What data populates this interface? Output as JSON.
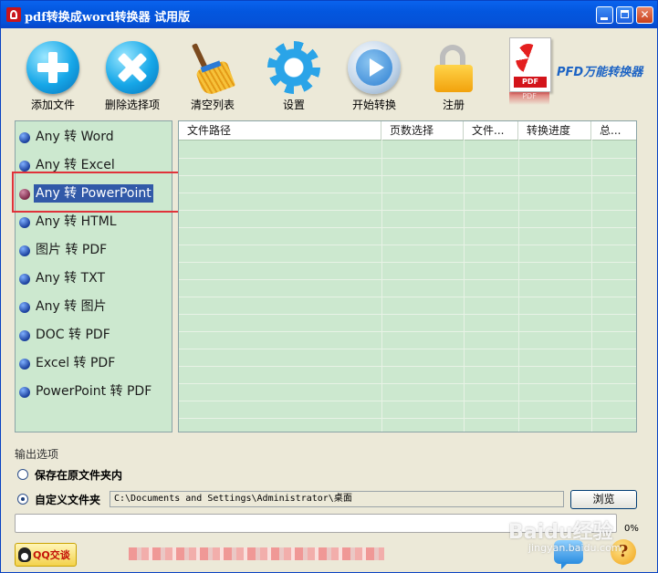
{
  "window": {
    "title": "pdf转换成word转换器 试用版"
  },
  "toolbar": {
    "add": "添加文件",
    "remove": "删除选择项",
    "clear": "清空列表",
    "settings": "设置",
    "start": "开始转换",
    "register": "注册"
  },
  "brand": {
    "name": "PFD万能转换器",
    "logo_text": "PDF"
  },
  "conversions": [
    {
      "label": "Any 转 Word"
    },
    {
      "label": "Any 转 Excel"
    },
    {
      "label": "Any 转 PowerPoint",
      "selected": true
    },
    {
      "label": "Any 转 HTML"
    },
    {
      "label": "图片 转 PDF"
    },
    {
      "label": "Any 转 TXT"
    },
    {
      "label": "Any 转 图片"
    },
    {
      "label": "DOC 转 PDF"
    },
    {
      "label": "Excel 转 PDF"
    },
    {
      "label": "PowerPoint 转 PDF"
    }
  ],
  "table": {
    "columns": [
      "文件路径",
      "页数选择",
      "文件...",
      "转换进度",
      "总..."
    ],
    "rows": []
  },
  "output": {
    "section_label": "输出选项",
    "option_original": "保存在原文件夹内",
    "option_custom": "自定义文件夹",
    "selected_option": "custom",
    "path": "C:\\Documents and Settings\\Administrator\\桌面",
    "browse": "浏览"
  },
  "progress": {
    "value": 0,
    "label": "0%"
  },
  "footer": {
    "qq_label": "QQ交谈"
  },
  "watermark": {
    "text": "Baidu经验",
    "sub": "jingyan.baidu.com"
  },
  "colors": {
    "panel_bg": "#cce8cf",
    "selection": "#3159a8",
    "highlight_box": "#e0323a",
    "titlebar": "#0356de"
  }
}
